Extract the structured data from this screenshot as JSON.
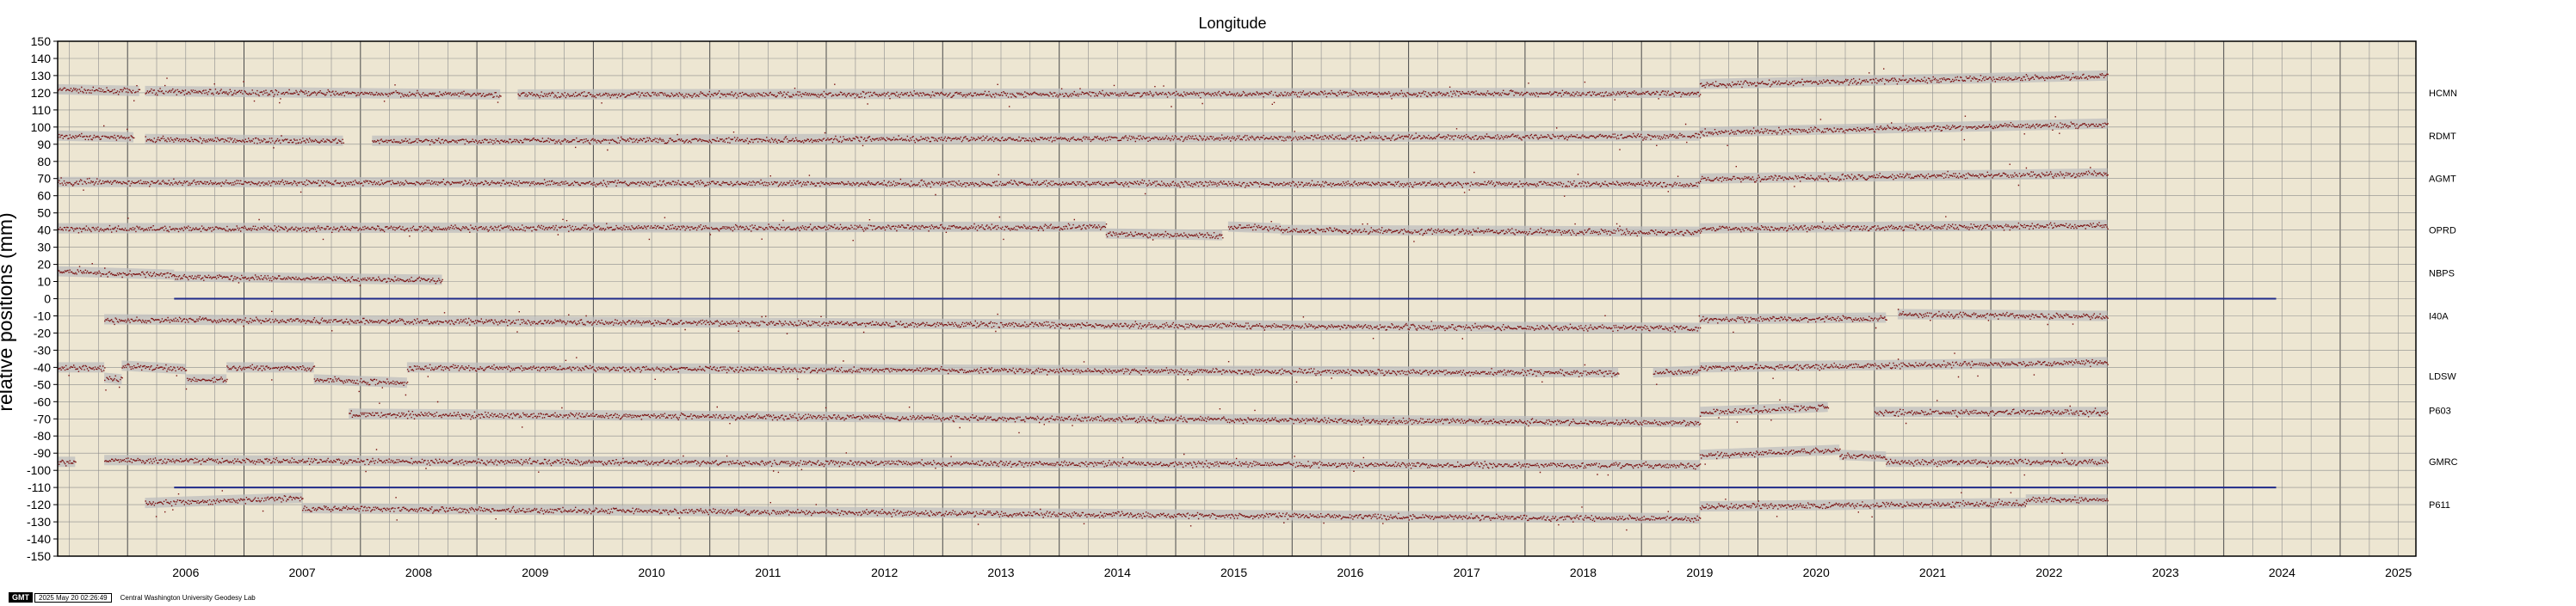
{
  "chart_data": {
    "type": "scatter",
    "title": "Longitude",
    "ylabel": "relative positions (mm)",
    "xlabel": "",
    "xlim": [
      2005.4,
      2025.65
    ],
    "ylim": [
      -150,
      150
    ],
    "ytick_step": 10,
    "x_ticks": [
      "2006",
      "2007",
      "2008",
      "2009",
      "2010",
      "2011",
      "2012",
      "2013",
      "2014",
      "2015",
      "2016",
      "2017",
      "2018",
      "2019",
      "2020",
      "2021",
      "2022",
      "2023",
      "2024",
      "2025"
    ],
    "grid": true,
    "background_color": "#ede6d2",
    "point_color": "#7a1010",
    "band_color": "#bdbdbd",
    "reference_line_color": "#1f2a8a",
    "reference_lines": [
      {
        "y": 0,
        "x_start": 2006.4,
        "x_end": 2024.45
      },
      {
        "y": -110,
        "x_start": 2006.4,
        "x_end": 2024.45
      }
    ],
    "series": [
      {
        "name": "HCMN",
        "segments": [
          {
            "x0": 2005.4,
            "x1": 2006.1,
            "y0": 122,
            "y1": 121
          },
          {
            "x0": 2006.15,
            "x1": 2009.2,
            "y0": 121,
            "y1": 119
          },
          {
            "x0": 2009.35,
            "x1": 2019.5,
            "y0": 119,
            "y1": 120
          },
          {
            "x0": 2019.5,
            "x1": 2023.0,
            "y0": 125,
            "y1": 130
          }
        ]
      },
      {
        "name": "RDMT",
        "segments": [
          {
            "x0": 2005.4,
            "x1": 2006.05,
            "y0": 95,
            "y1": 94
          },
          {
            "x0": 2006.15,
            "x1": 2007.85,
            "y0": 93,
            "y1": 92
          },
          {
            "x0": 2008.1,
            "x1": 2019.5,
            "y0": 92,
            "y1": 95
          },
          {
            "x0": 2019.5,
            "x1": 2023.0,
            "y0": 97,
            "y1": 102
          }
        ]
      },
      {
        "name": "AGMT",
        "segments": [
          {
            "x0": 2005.4,
            "x1": 2019.5,
            "y0": 68,
            "y1": 67
          },
          {
            "x0": 2019.5,
            "x1": 2023.0,
            "y0": 70,
            "y1": 73
          }
        ]
      },
      {
        "name": "OPRD",
        "segments": [
          {
            "x0": 2005.4,
            "x1": 2014.4,
            "y0": 41,
            "y1": 42
          },
          {
            "x0": 2014.4,
            "x1": 2015.4,
            "y0": 38,
            "y1": 37
          },
          {
            "x0": 2015.45,
            "x1": 2015.9,
            "y0": 42,
            "y1": 41
          },
          {
            "x0": 2015.9,
            "x1": 2019.5,
            "y0": 40,
            "y1": 39
          },
          {
            "x0": 2019.5,
            "x1": 2023.0,
            "y0": 41,
            "y1": 43
          }
        ]
      },
      {
        "name": "NBPS",
        "segments": [
          {
            "x0": 2005.4,
            "x1": 2006.4,
            "y0": 16,
            "y1": 14
          },
          {
            "x0": 2006.4,
            "x1": 2008.7,
            "y0": 13,
            "y1": 11
          }
        ]
      },
      {
        "name": "I40A",
        "segments": [
          {
            "x0": 2005.8,
            "x1": 2019.5,
            "y0": -12,
            "y1": -17
          },
          {
            "x0": 2019.5,
            "x1": 2021.1,
            "y0": -12,
            "y1": -11
          },
          {
            "x0": 2021.2,
            "x1": 2023.0,
            "y0": -9,
            "y1": -10
          }
        ]
      },
      {
        "name": "LDSW",
        "segments": [
          {
            "x0": 2005.4,
            "x1": 2005.8,
            "y0": -40,
            "y1": -40
          },
          {
            "x0": 2005.8,
            "x1": 2005.95,
            "y0": -46,
            "y1": -47
          },
          {
            "x0": 2005.95,
            "x1": 2006.5,
            "y0": -39,
            "y1": -41
          },
          {
            "x0": 2006.5,
            "x1": 2006.85,
            "y0": -47,
            "y1": -47
          },
          {
            "x0": 2006.85,
            "x1": 2007.6,
            "y0": -40,
            "y1": -40
          },
          {
            "x0": 2007.6,
            "x1": 2008.4,
            "y0": -47,
            "y1": -49
          },
          {
            "x0": 2008.4,
            "x1": 2018.8,
            "y0": -40,
            "y1": -43
          },
          {
            "x0": 2019.1,
            "x1": 2019.5,
            "y0": -43,
            "y1": -42
          },
          {
            "x0": 2019.5,
            "x1": 2023.0,
            "y0": -40,
            "y1": -37
          }
        ]
      },
      {
        "name": "P603",
        "segments": [
          {
            "x0": 2007.9,
            "x1": 2019.5,
            "y0": -67,
            "y1": -72
          },
          {
            "x0": 2019.5,
            "x1": 2020.6,
            "y0": -66,
            "y1": -63
          },
          {
            "x0": 2021.0,
            "x1": 2023.0,
            "y0": -66,
            "y1": -66
          }
        ]
      },
      {
        "name": "GMRC",
        "segments": [
          {
            "x0": 2005.4,
            "x1": 2005.55,
            "y0": -95,
            "y1": -95
          },
          {
            "x0": 2005.8,
            "x1": 2019.5,
            "y0": -94,
            "y1": -97
          },
          {
            "x0": 2019.5,
            "x1": 2020.7,
            "y0": -91,
            "y1": -88
          },
          {
            "x0": 2020.7,
            "x1": 2021.1,
            "y0": -91,
            "y1": -92
          },
          {
            "x0": 2021.1,
            "x1": 2023.0,
            "y0": -95,
            "y1": -95
          }
        ]
      },
      {
        "name": "P611",
        "segments": [
          {
            "x0": 2006.15,
            "x1": 2007.5,
            "y0": -119,
            "y1": -116
          },
          {
            "x0": 2007.5,
            "x1": 2019.5,
            "y0": -122,
            "y1": -128
          },
          {
            "x0": 2019.5,
            "x1": 2022.3,
            "y0": -121,
            "y1": -119
          },
          {
            "x0": 2022.3,
            "x1": 2023.0,
            "y0": -117,
            "y1": -117
          }
        ]
      }
    ]
  },
  "footer": {
    "logo": "GMT",
    "timestamp": "2025 May 20 02:26:49",
    "organization": "Central Washington University Geodesy Lab"
  }
}
